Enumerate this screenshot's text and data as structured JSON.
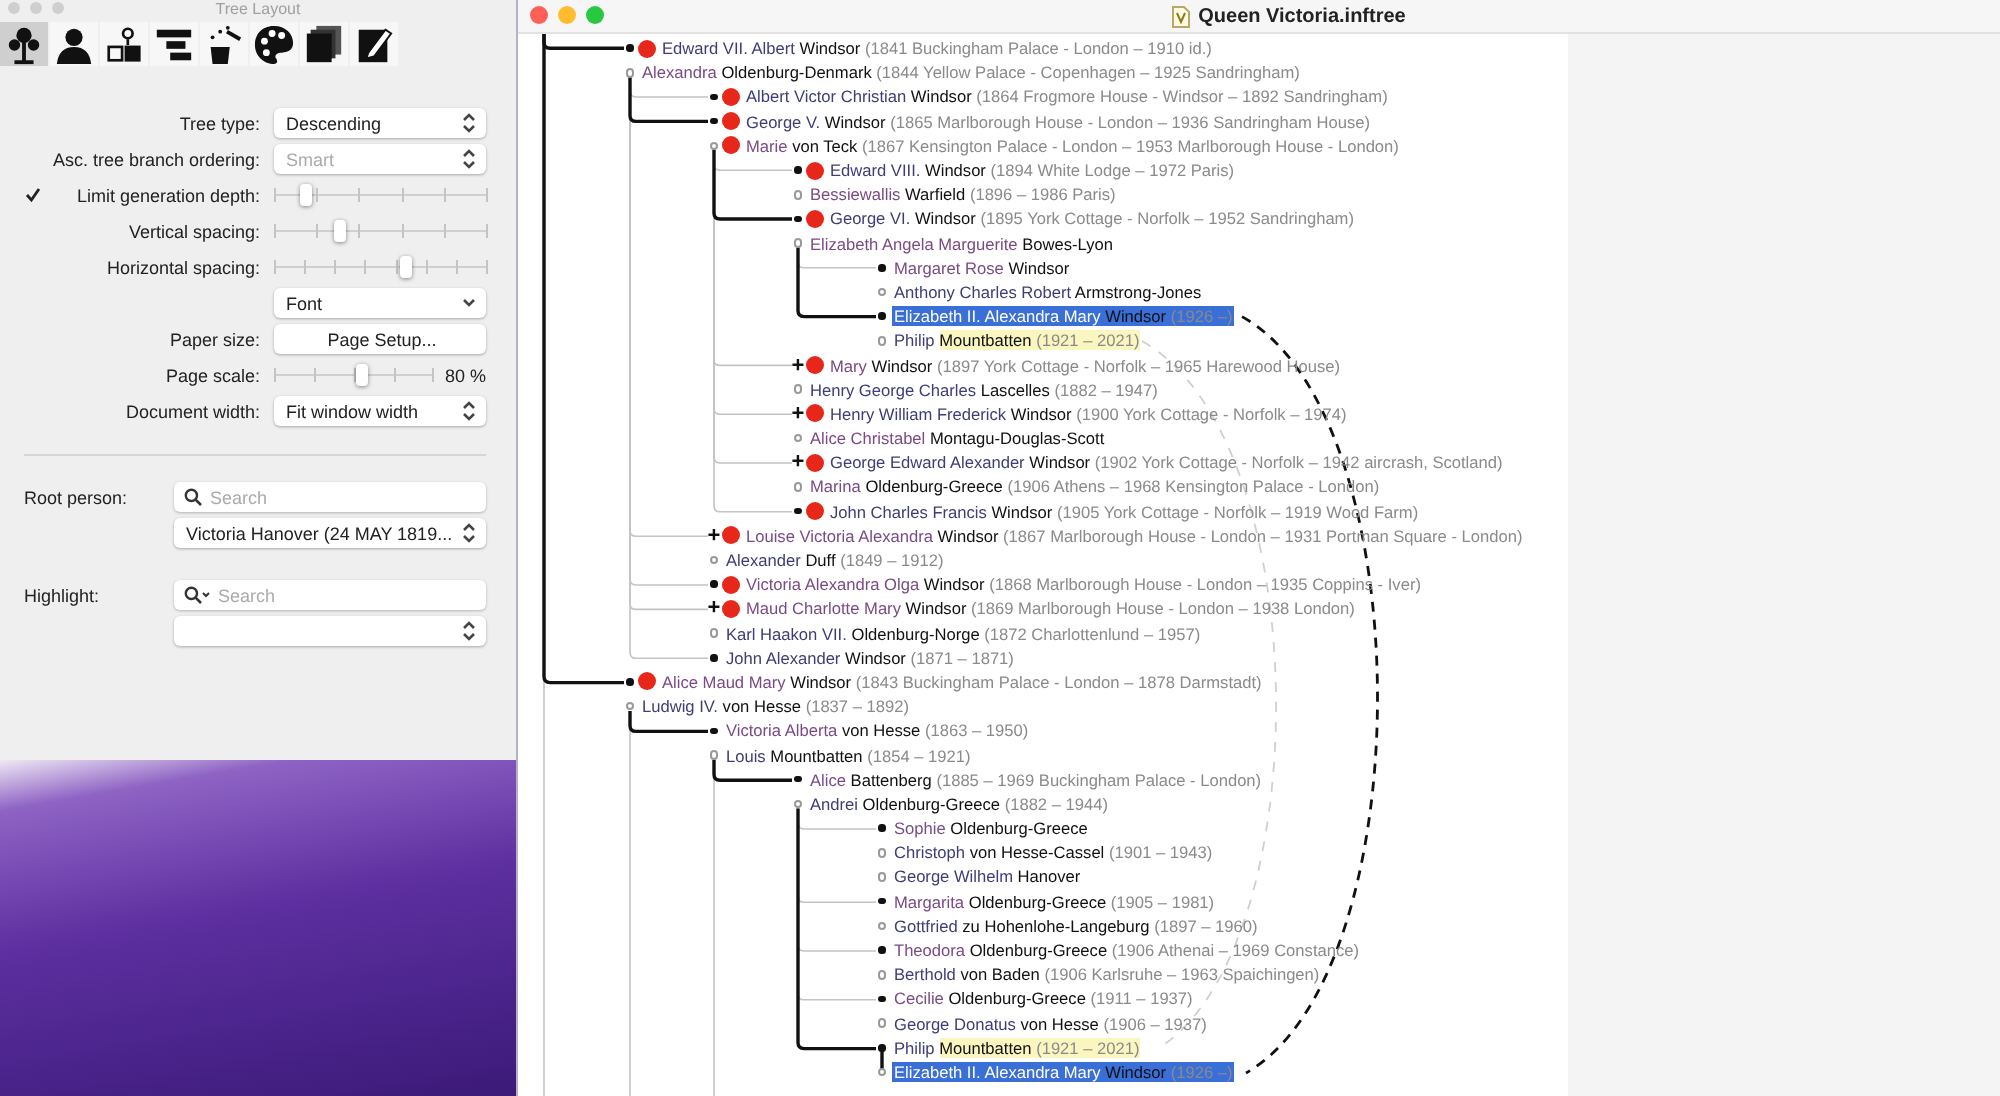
{
  "inspector": {
    "title": "Tree Layout",
    "toolbar": [
      {
        "kind": "tree",
        "selected": true
      },
      {
        "kind": "person",
        "selected": false
      },
      {
        "kind": "place",
        "selected": false
      },
      {
        "kind": "bars",
        "selected": false
      },
      {
        "kind": "magic",
        "selected": false
      },
      {
        "kind": "palette",
        "selected": false
      },
      {
        "kind": "pages",
        "selected": false
      },
      {
        "kind": "edit",
        "selected": false
      }
    ],
    "settings": [
      {
        "kind": "select",
        "label": "Tree type:",
        "value": "Descending",
        "disabled": false
      },
      {
        "kind": "select",
        "label": "Asc. tree branch ordering:",
        "value": "Smart",
        "disabled": true
      },
      {
        "kind": "slider",
        "label": "Limit generation depth:",
        "checked": true,
        "level": 0.15
      },
      {
        "kind": "slider",
        "label": "Vertical spacing:",
        "level": 0.31
      },
      {
        "kind": "slider",
        "label": "Horizontal spacing:",
        "level": 0.62
      },
      {
        "kind": "popdown",
        "value": "Font"
      },
      {
        "kind": "button",
        "label": "Paper size:",
        "value": "Page Setup..."
      },
      {
        "kind": "slider",
        "label": "Page scale:",
        "level": 0.55,
        "reading": "80 %"
      },
      {
        "kind": "select",
        "label": "Document width:",
        "value": "Fit window width",
        "disabled": false
      }
    ],
    "root_person": {
      "label": "Root person:",
      "placeholder": "Search",
      "value": "Victoria Hanover (24 MAY 1819..."
    },
    "highlight": {
      "label": "Highlight:",
      "placeholder": "Search"
    }
  },
  "document_window": {
    "title": "Queen Victoria.inftree",
    "tree": {
      "more_below": true,
      "children": [
        {
          "person": {
            "given": "Edward VII. Albert",
            "surname": "Windsor",
            "dates": "(1841 Buckingham Palace - London – 1910 id.)",
            "color": "#3d3d78",
            "marked": true,
            "selected": false,
            "highlighted": false
          },
          "spouses": [
            {
              "given": "Alexandra",
              "surname": "Oldenburg-Denmark",
              "dates": "(1844 Yellow Palace - Copenhagen – 1925 Sandringham)",
              "color": "#7b4a86",
              "marked": false,
              "selected": false,
              "highlighted": false
            }
          ],
          "children": [
            {
              "person": {
                "given": "Albert Victor Christian",
                "surname": "Windsor",
                "dates": "(1864 Frogmore House - Windsor – 1892 Sandringham)",
                "color": "#3d3d78",
                "marked": true,
                "selected": false,
                "highlighted": false
              }
            },
            {
              "person": {
                "given": "George V.",
                "surname": "Windsor",
                "dates": "(1865 Marlborough House - London – 1936 Sandringham House)",
                "color": "#3d3d78",
                "marked": true,
                "selected": false,
                "highlighted": false
              },
              "spouses": [
                {
                  "given": "Marie",
                  "surname": "von Teck",
                  "dates": "(1867 Kensington Palace - London – 1953 Marlborough House - London)",
                  "color": "#7b4a86",
                  "marked": true,
                  "selected": false,
                  "highlighted": false
                }
              ],
              "children": [
                {
                  "person": {
                    "given": "Edward VIII.",
                    "surname": "Windsor",
                    "dates": "(1894 White Lodge – 1972 Paris)",
                    "color": "#3d3d78",
                    "marked": true,
                    "selected": false,
                    "highlighted": false
                  },
                  "spouses": [
                    {
                      "given": "Bessiewallis",
                      "surname": "Warfield",
                      "dates": "(1896 – 1986 Paris)",
                      "color": "#7b4a86",
                      "marked": false,
                      "selected": false,
                      "highlighted": false
                    }
                  ]
                },
                {
                  "person": {
                    "given": "George VI.",
                    "surname": "Windsor",
                    "dates": "(1895 York Cottage - Norfolk – 1952 Sandringham)",
                    "color": "#3d3d78",
                    "marked": true,
                    "selected": false,
                    "highlighted": false
                  },
                  "spouses": [
                    {
                      "given": "Elizabeth Angela Marguerite",
                      "surname": "Bowes-Lyon",
                      "color": "#7b4a86",
                      "marked": false,
                      "selected": false,
                      "highlighted": false
                    }
                  ],
                  "children": [
                    {
                      "person": {
                        "given": "Margaret Rose",
                        "surname": "Windsor",
                        "color": "#7b4a86",
                        "marked": false,
                        "selected": false,
                        "highlighted": false
                      },
                      "spouses": [
                        {
                          "given": "Anthony Charles Robert",
                          "surname": "Armstrong-Jones",
                          "color": "#3d3d78",
                          "marked": false,
                          "selected": false,
                          "highlighted": false
                        }
                      ]
                    },
                    {
                      "person": {
                        "given": "Elizabeth II. Alexandra Mary",
                        "surname": "Windsor",
                        "dates": "(1926 –)",
                        "marked": false,
                        "selected": true,
                        "highlighted": false
                      },
                      "spouses": [
                        {
                          "given": "Philip",
                          "surname": "Mountbatten",
                          "dates": "(1921 – 2021)",
                          "color": "#3d3d78",
                          "marked": false,
                          "selected": false,
                          "highlighted": true
                        }
                      ]
                    }
                  ]
                },
                {
                  "person": {
                    "given": "Mary",
                    "surname": "Windsor",
                    "dates": "(1897 York Cottage - Norfolk – 1965 Harewood House)",
                    "color": "#7b4a86",
                    "marked": true,
                    "selected": false,
                    "highlighted": false,
                    "toggle": "+"
                  },
                  "spouses": [
                    {
                      "given": "Henry George Charles",
                      "surname": "Lascelles",
                      "dates": "(1882 – 1947)",
                      "color": "#3d3d78",
                      "marked": false,
                      "selected": false,
                      "highlighted": false
                    }
                  ]
                },
                {
                  "person": {
                    "given": "Henry William Frederick",
                    "surname": "Windsor",
                    "dates": "(1900 York Cottage - Norfolk – 1974)",
                    "color": "#3d3d78",
                    "marked": true,
                    "selected": false,
                    "highlighted": false,
                    "toggle": "+"
                  },
                  "spouses": [
                    {
                      "given": "Alice Christabel",
                      "surname": "Montagu-Douglas-Scott",
                      "color": "#7b4a86",
                      "marked": false,
                      "selected": false,
                      "highlighted": false
                    }
                  ]
                },
                {
                  "person": {
                    "given": "George Edward Alexander",
                    "surname": "Windsor",
                    "dates": "(1902 York Cottage - Norfolk – 1942 aircrash, Scotland)",
                    "color": "#3d3d78",
                    "marked": true,
                    "selected": false,
                    "highlighted": false,
                    "toggle": "+"
                  },
                  "spouses": [
                    {
                      "given": "Marina",
                      "surname": "Oldenburg-Greece",
                      "dates": "(1906 Athens – 1968 Kensington Palace - London)",
                      "color": "#7b4a86",
                      "marked": false,
                      "selected": false,
                      "highlighted": false
                    }
                  ]
                },
                {
                  "person": {
                    "given": "John Charles Francis",
                    "surname": "Windsor",
                    "dates": "(1905 York Cottage - Norfolk – 1919 Wood Farm)",
                    "color": "#3d3d78",
                    "marked": true,
                    "selected": false,
                    "highlighted": false
                  }
                }
              ]
            },
            {
              "person": {
                "given": "Louise Victoria Alexandra",
                "surname": "Windsor",
                "dates": "(1867 Marlborough House - London – 1931 Portman Square - London)",
                "color": "#7b4a86",
                "marked": true,
                "selected": false,
                "highlighted": false,
                "toggle": "+"
              },
              "spouses": [
                {
                  "given": "Alexander",
                  "surname": "Duff",
                  "dates": "(1849 – 1912)",
                  "color": "#3d3d78",
                  "marked": false,
                  "selected": false,
                  "highlighted": false
                }
              ]
            },
            {
              "person": {
                "given": "Victoria Alexandra Olga",
                "surname": "Windsor",
                "dates": "(1868 Marlborough House - London – 1935 Coppins - Iver)",
                "color": "#7b4a86",
                "marked": true,
                "selected": false,
                "highlighted": false
              }
            },
            {
              "person": {
                "given": "Maud Charlotte Mary",
                "surname": "Windsor",
                "dates": "(1869 Marlborough House - London – 1938 London)",
                "color": "#7b4a86",
                "marked": true,
                "selected": false,
                "highlighted": false,
                "toggle": "+"
              },
              "spouses": [
                {
                  "given": "Karl Haakon VII.",
                  "surname": "Oldenburg-Norge",
                  "dates": "(1872 Charlottenlund – 1957)",
                  "color": "#3d3d78",
                  "marked": false,
                  "selected": false,
                  "highlighted": false
                }
              ]
            },
            {
              "person": {
                "given": "John Alexander",
                "surname": "Windsor",
                "dates": "(1871 – 1871)",
                "color": "#3d3d78",
                "marked": false,
                "selected": false,
                "highlighted": false
              }
            }
          ]
        },
        {
          "person": {
            "given": "Alice Maud Mary",
            "surname": "Windsor",
            "dates": "(1843 Buckingham Palace - London – 1878 Darmstadt)",
            "color": "#7b4a86",
            "marked": true,
            "selected": false,
            "highlighted": false
          },
          "spouses": [
            {
              "given": "Ludwig IV.",
              "surname": "von Hesse",
              "dates": "(1837 – 1892)",
              "color": "#3d3d78",
              "marked": false,
              "selected": false,
              "highlighted": false
            }
          ],
          "more_below": true,
          "children": [
            {
              "person": {
                "given": "Victoria Alberta",
                "surname": "von Hesse",
                "dates": "(1863 – 1950)",
                "color": "#7b4a86",
                "marked": false,
                "selected": false,
                "highlighted": false
              },
              "spouses": [
                {
                  "given": "Louis",
                  "surname": "Mountbatten",
                  "dates": "(1854 – 1921)",
                  "color": "#3d3d78",
                  "marked": false,
                  "selected": false,
                  "highlighted": false
                }
              ],
              "more_below": true,
              "children": [
                {
                  "person": {
                    "given": "Alice",
                    "surname": "Battenberg",
                    "dates": "(1885 – 1969 Buckingham Palace - London)",
                    "color": "#7b4a86",
                    "marked": false,
                    "selected": false,
                    "highlighted": false
                  },
                  "spouses": [
                    {
                      "given": "Andrei",
                      "surname": "Oldenburg-Greece",
                      "dates": "(1882 – 1944)",
                      "color": "#3d3d78",
                      "marked": false,
                      "selected": false,
                      "highlighted": false
                    }
                  ],
                  "children": [
                    {
                      "person": {
                        "given": "Sophie",
                        "surname": "Oldenburg-Greece",
                        "color": "#7b4a86",
                        "marked": false,
                        "selected": false,
                        "highlighted": false
                      },
                      "spouses": [
                        {
                          "given": "Christoph",
                          "surname": "von Hesse-Cassel",
                          "dates": "(1901 – 1943)",
                          "color": "#3d3d78",
                          "marked": false,
                          "selected": false,
                          "highlighted": false
                        },
                        {
                          "given": "George Wilhelm",
                          "surname": "Hanover",
                          "color": "#3d3d78",
                          "marked": false,
                          "selected": false,
                          "highlighted": false
                        }
                      ]
                    },
                    {
                      "person": {
                        "given": "Margarita",
                        "surname": "Oldenburg-Greece",
                        "dates": "(1905 – 1981)",
                        "color": "#7b4a86",
                        "marked": false,
                        "selected": false,
                        "highlighted": false
                      },
                      "spouses": [
                        {
                          "given": "Gottfried",
                          "surname": "zu Hohenlohe-Langeburg",
                          "dates": "(1897 – 1960)",
                          "color": "#3d3d78",
                          "marked": false,
                          "selected": false,
                          "highlighted": false
                        }
                      ]
                    },
                    {
                      "person": {
                        "given": "Theodora",
                        "surname": "Oldenburg-Greece",
                        "dates": "(1906 Athenai – 1969 Constance)",
                        "color": "#7b4a86",
                        "marked": false,
                        "selected": false,
                        "highlighted": false
                      },
                      "spouses": [
                        {
                          "given": "Berthold",
                          "surname": "von Baden",
                          "dates": "(1906 Karlsruhe – 1963 Spaichingen)",
                          "color": "#3d3d78",
                          "marked": false,
                          "selected": false,
                          "highlighted": false
                        }
                      ]
                    },
                    {
                      "person": {
                        "given": "Cecilie",
                        "surname": "Oldenburg-Greece",
                        "dates": "(1911 – 1937)",
                        "color": "#7b4a86",
                        "marked": false,
                        "selected": false,
                        "highlighted": false
                      },
                      "spouses": [
                        {
                          "given": "George Donatus",
                          "surname": "von Hesse",
                          "dates": "(1906 – 1937)",
                          "color": "#3d3d78",
                          "marked": false,
                          "selected": false,
                          "highlighted": false
                        }
                      ]
                    },
                    {
                      "person": {
                        "given": "Philip",
                        "surname": "Mountbatten",
                        "dates": "(1921 – 2021)",
                        "color": "#3d3d78",
                        "marked": false,
                        "selected": false,
                        "highlighted": true
                      },
                      "spouses": [
                        {
                          "given": "Elizabeth II. Alexandra Mary",
                          "surname": "Windsor",
                          "dates": "(1926 –)",
                          "marked": false,
                          "selected": true,
                          "highlighted": false
                        }
                      ]
                    }
                  ]
                }
              ]
            }
          ]
        }
      ]
    }
  }
}
